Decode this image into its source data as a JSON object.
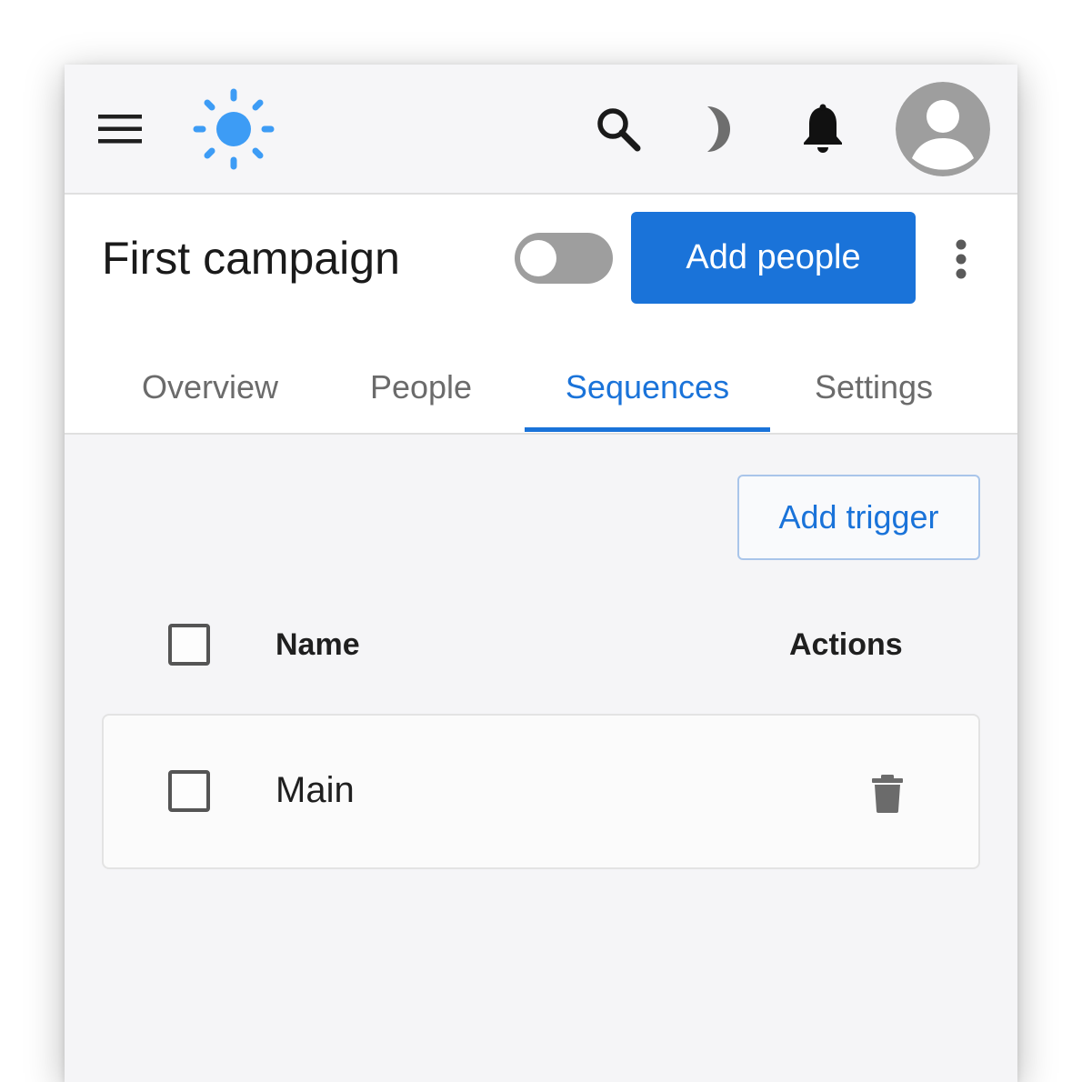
{
  "app": {
    "icons": {
      "menu": "menu-icon",
      "logo": "sun-icon",
      "search": "search-icon",
      "theme": "moon-icon",
      "notifications": "bell-icon",
      "avatar": "account-circle-icon"
    },
    "colors": {
      "accent": "#1a73d9",
      "logo": "#3d9cf5",
      "toggle_off": "#9e9e9e"
    }
  },
  "campaign": {
    "title": "First campaign",
    "active_toggle_on": false,
    "add_people_label": "Add people"
  },
  "tabs": [
    {
      "label": "Overview",
      "active": false
    },
    {
      "label": "People",
      "active": false
    },
    {
      "label": "Sequences",
      "active": true
    },
    {
      "label": "Settings",
      "active": false
    }
  ],
  "sequences": {
    "add_trigger_label": "Add trigger",
    "columns": {
      "name": "Name",
      "actions": "Actions"
    },
    "rows": [
      {
        "name": "Main",
        "checked": false,
        "action_icon": "trash-icon"
      }
    ]
  }
}
